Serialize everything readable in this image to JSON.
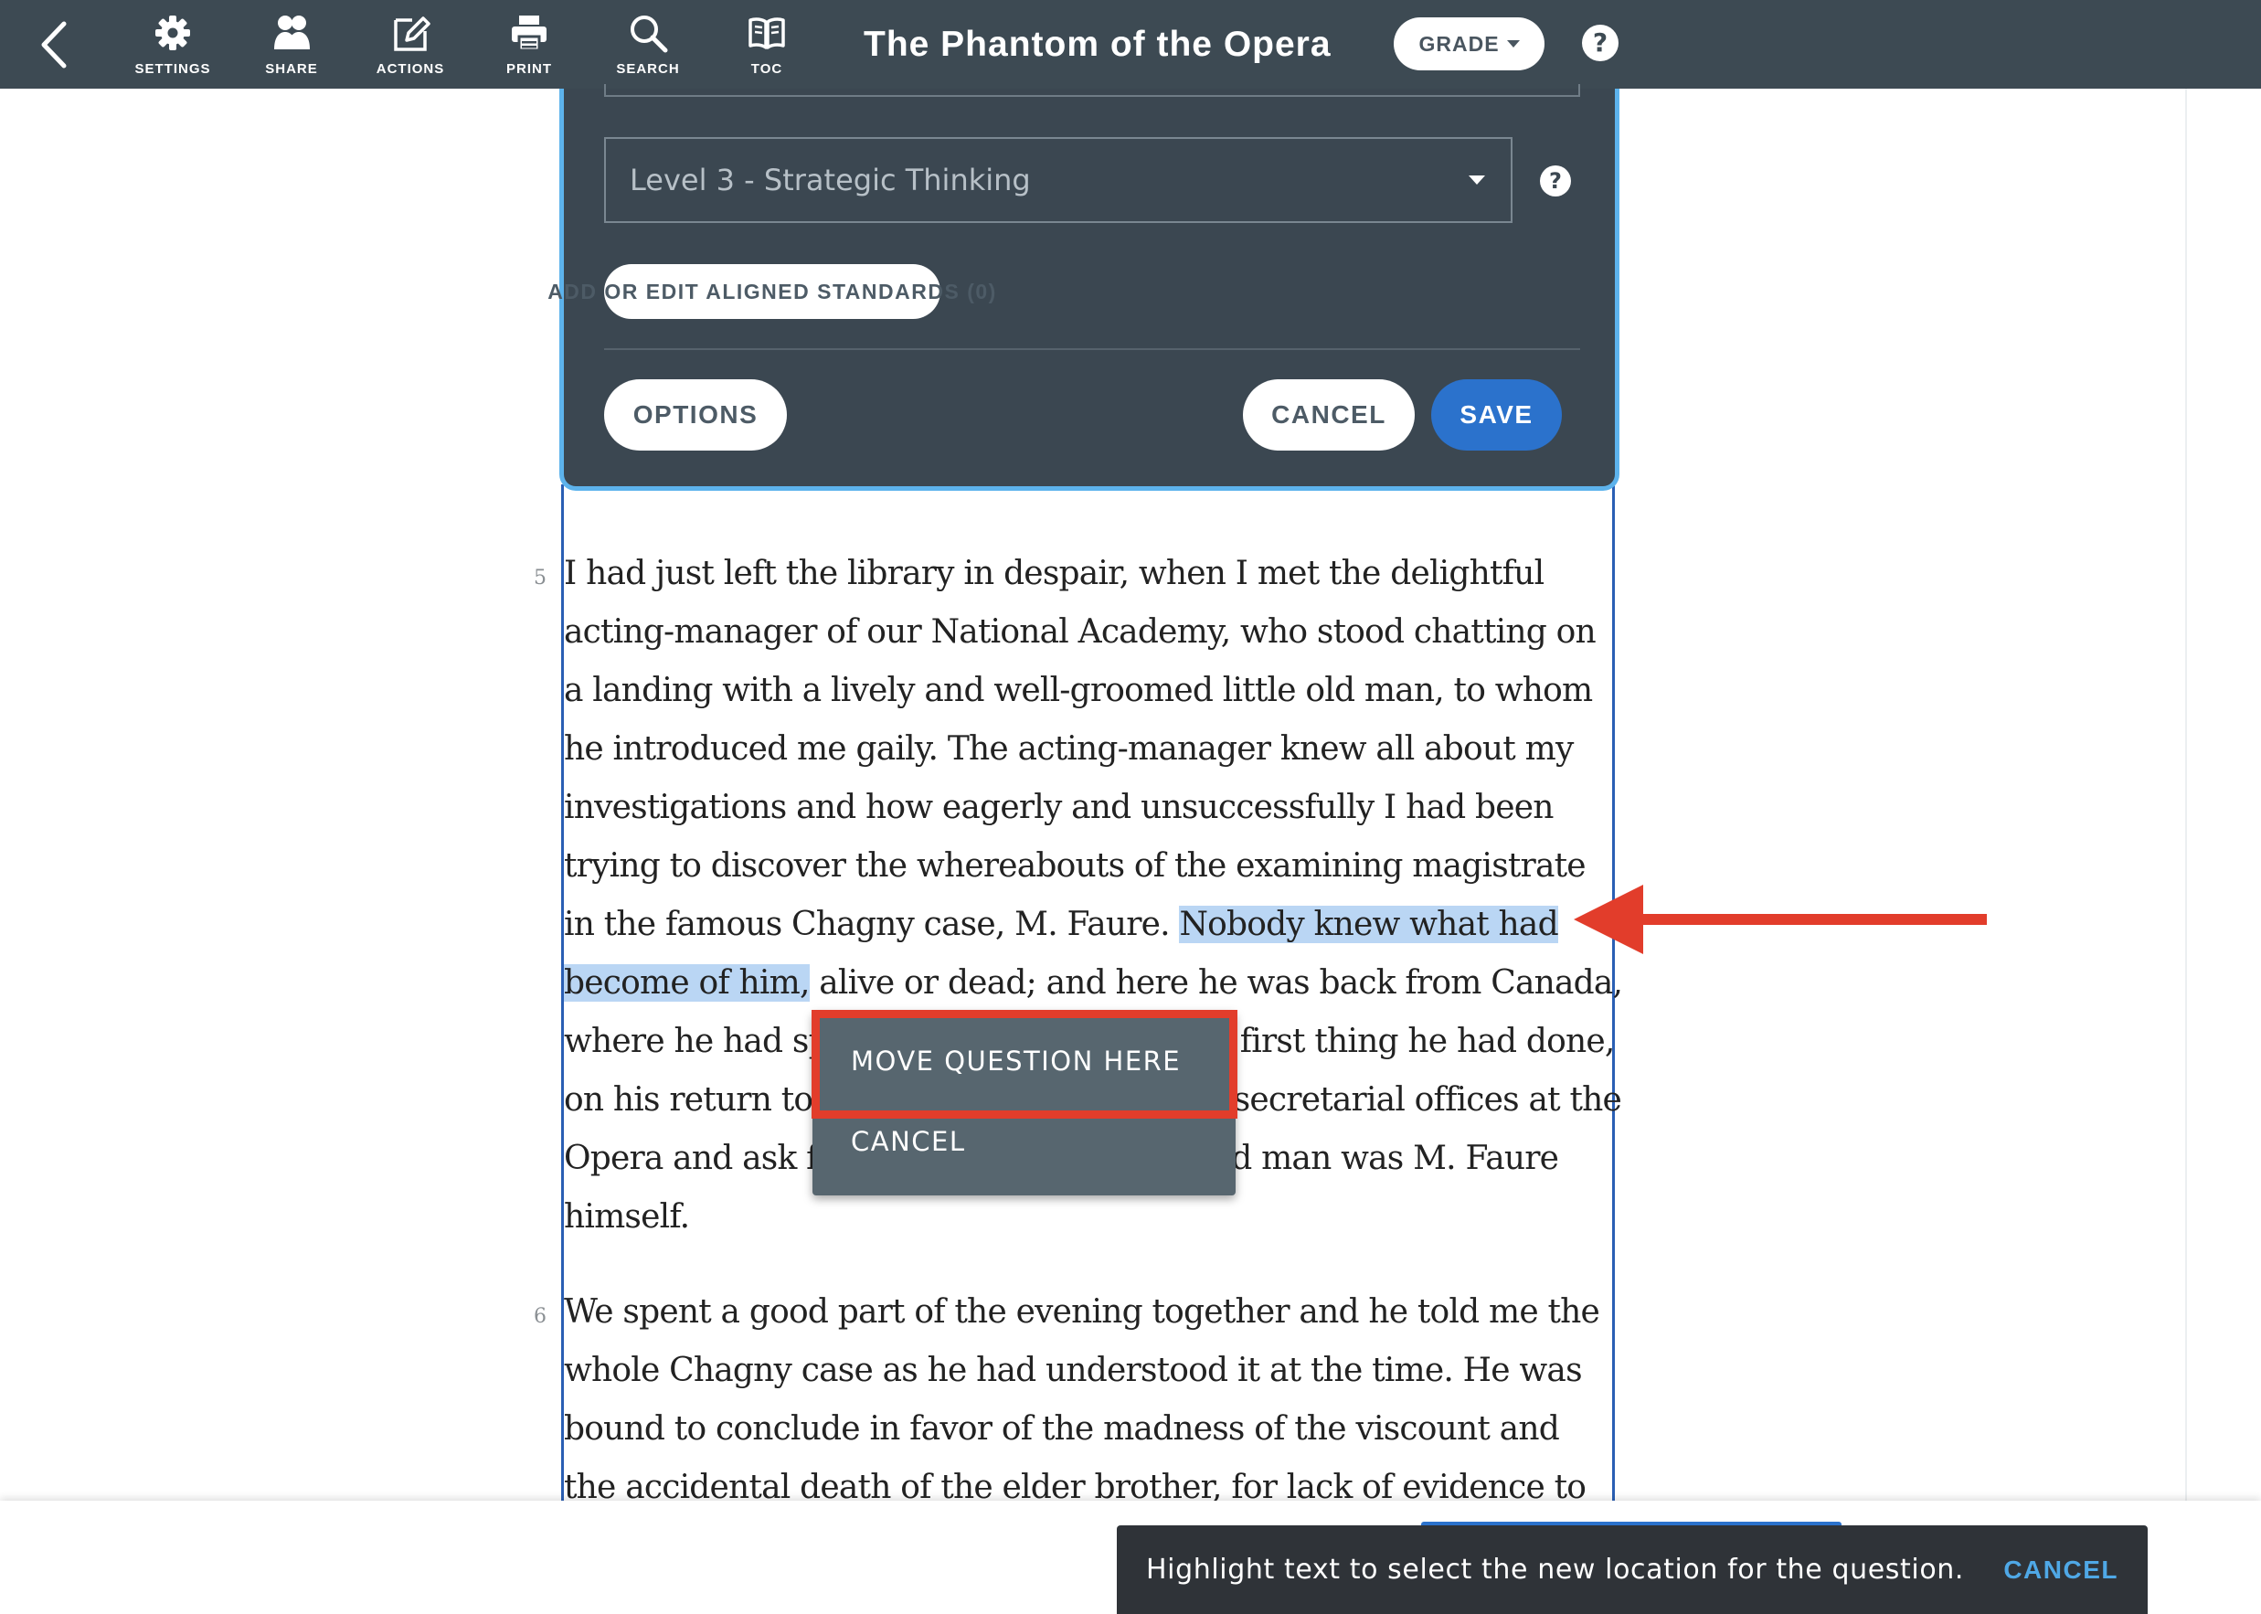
{
  "toolbar": {
    "back_icon": "chevron-left-icon",
    "tools": [
      {
        "label": "SETTINGS",
        "icon": "gear-icon"
      },
      {
        "label": "SHARE",
        "icon": "users-icon"
      },
      {
        "label": "ACTIONS",
        "icon": "edit-icon"
      },
      {
        "label": "PRINT",
        "icon": "printer-icon"
      },
      {
        "label": "SEARCH",
        "icon": "search-icon"
      },
      {
        "label": "TOC",
        "icon": "book-icon"
      }
    ],
    "title": "The Phantom of the Opera",
    "grade_label": "GRADE",
    "help_glyph": "?"
  },
  "editor": {
    "dok_selected": "Level 3 - Strategic Thinking",
    "dok_help_glyph": "?",
    "standards_button": "ADD OR EDIT ALIGNED STANDARDS (0)",
    "options_button": "OPTIONS",
    "cancel_button": "CANCEL",
    "save_button": "SAVE",
    "accent_color": "#5db3ec",
    "save_color": "#2b72cc"
  },
  "reading": {
    "paragraphs": [
      {
        "number": "5",
        "lines": [
          "I had just left the library in despair, when I met the delightful",
          "acting-manager of our National Academy, who stood chatting on",
          "a landing with a lively and well-groomed little old man, to whom",
          "he introduced me gaily. The acting-manager knew all about my",
          "investigations and how eagerly and unsuccessfully I had been",
          "trying to discover the whereabouts of the examining magistrate",
          {
            "before": "in the famous Chagny case, M. Faure. ",
            "highlight": "Nobody knew what had"
          },
          {
            "highlight": "become of him,",
            "after": " alive or dead; and here he was back from Canada,"
          },
          "where he had spent fifteen years, and the first thing he had done,",
          "on his return to Paris, was to come to the secretarial offices at the",
          "Opera and ask for a free seat. The little old man was M. Faure",
          "himself."
        ]
      },
      {
        "number": "6",
        "lines": [
          "We spent a good part of the evening together and he told me the",
          "whole Chagny case as he had understood it at the time. He was",
          "bound to conclude in favor of the madness of the viscount and",
          "the accidental death of the elder brother, for lack of evidence to"
        ]
      }
    ],
    "highlight_color": "#bad6f4"
  },
  "context_menu": {
    "move_here": "MOVE QUESTION HERE",
    "cancel": "CANCEL",
    "annotation_color": "#e23d2b"
  },
  "snackbar": {
    "message": "Highlight text to select the new location for the question.",
    "cancel": "CANCEL"
  }
}
